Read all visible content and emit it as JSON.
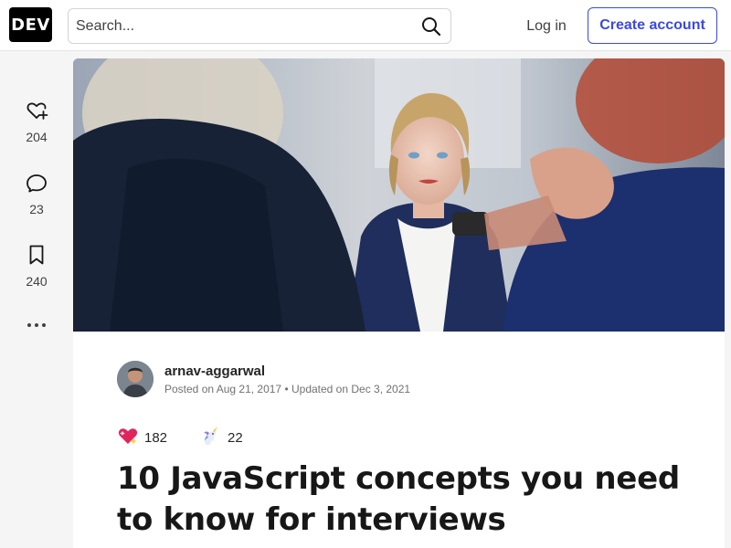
{
  "header": {
    "logo_text": "DEV",
    "search": {
      "placeholder": "Search..."
    },
    "login_label": "Log in",
    "create_account_label": "Create account",
    "accent_color": "#3b49df"
  },
  "sidebar": {
    "actions": [
      {
        "icon": "heart-plus-icon",
        "count": "204"
      },
      {
        "icon": "comment-icon",
        "count": "23"
      },
      {
        "icon": "bookmark-icon",
        "count": "240"
      },
      {
        "icon": "more-icon"
      }
    ]
  },
  "article": {
    "author": {
      "name": "arnav-aggarwal",
      "meta": "Posted on Aug 21, 2017 • Updated on Dec 3, 2021"
    },
    "reactions": [
      {
        "icon": "sparkle-heart-icon",
        "count": "182"
      },
      {
        "icon": "unicorn-icon",
        "count": "22"
      }
    ],
    "title": "10 JavaScript concepts you need to know for interviews"
  }
}
